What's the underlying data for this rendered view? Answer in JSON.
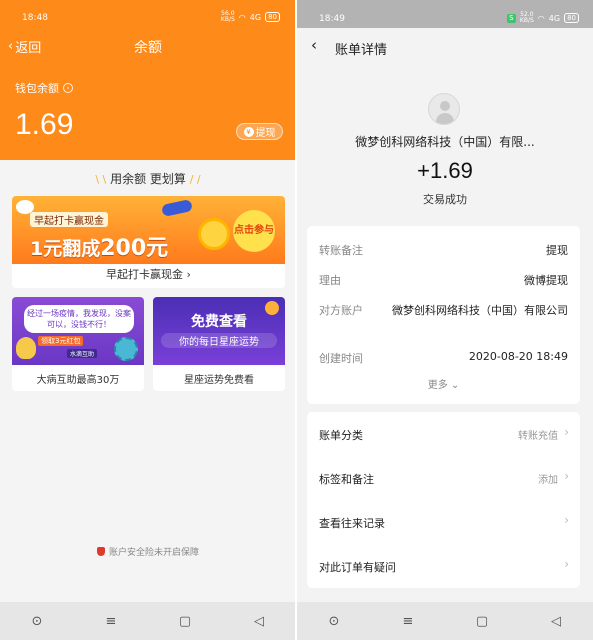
{
  "left": {
    "status": {
      "time": "18:48",
      "net_speed_top": "56.0",
      "net_speed_bottom": "KB/S",
      "signal": "4G",
      "battery": "80"
    },
    "nav": {
      "back_label": "返回",
      "title": "余额"
    },
    "wallet": {
      "label": "钱包余额",
      "balance": "1.69",
      "withdraw_label": "提现"
    },
    "section_title": "用余额 更划算",
    "banner": {
      "small_title": "早起打卡赢现金",
      "big_prefix": "1元翻成",
      "big_number": "200元",
      "cta": "点击参与",
      "caption": "早起打卡赢现金"
    },
    "promos": [
      {
        "bubble": "经过一场疫情，我发现，没案可以，没钱不行！",
        "tag": "领取3元红包",
        "logo": "水滴互助",
        "caption": "大病互助最高30万"
      },
      {
        "title": "免费查看",
        "subtitle": "你的每日星座运势",
        "caption": "星座运势免费看"
      }
    ],
    "safety_note": "账户安全险未开启保障"
  },
  "right": {
    "status": {
      "time": "18:49",
      "net_speed_top": "52.0",
      "net_speed_bottom": "KB/S",
      "signal": "4G",
      "battery": "80"
    },
    "header": {
      "title": "账单详情"
    },
    "merchant": "微梦创科网络科技（中国）有限...",
    "amount": "+1.69",
    "trade_status": "交易成功",
    "details": [
      {
        "key": "转账备注",
        "value": "提现"
      },
      {
        "key": "理由",
        "value": "微博提现"
      },
      {
        "key": "对方账户",
        "value": "微梦创科网络科技（中国）有限公司"
      },
      {
        "key": "创建时间",
        "value": "2020-08-20 18:49"
      }
    ],
    "more_label": "更多",
    "menu": [
      {
        "label": "账单分类",
        "value": "转账充值"
      },
      {
        "label": "标签和备注",
        "value": "添加"
      },
      {
        "label": "查看往来记录",
        "value": ""
      },
      {
        "label": "对此订单有疑问",
        "value": ""
      }
    ]
  },
  "colors": {
    "brand_orange": "#fe8a19",
    "page_bg": "#f4f4f4",
    "status_gray": "#b3b3b3"
  }
}
